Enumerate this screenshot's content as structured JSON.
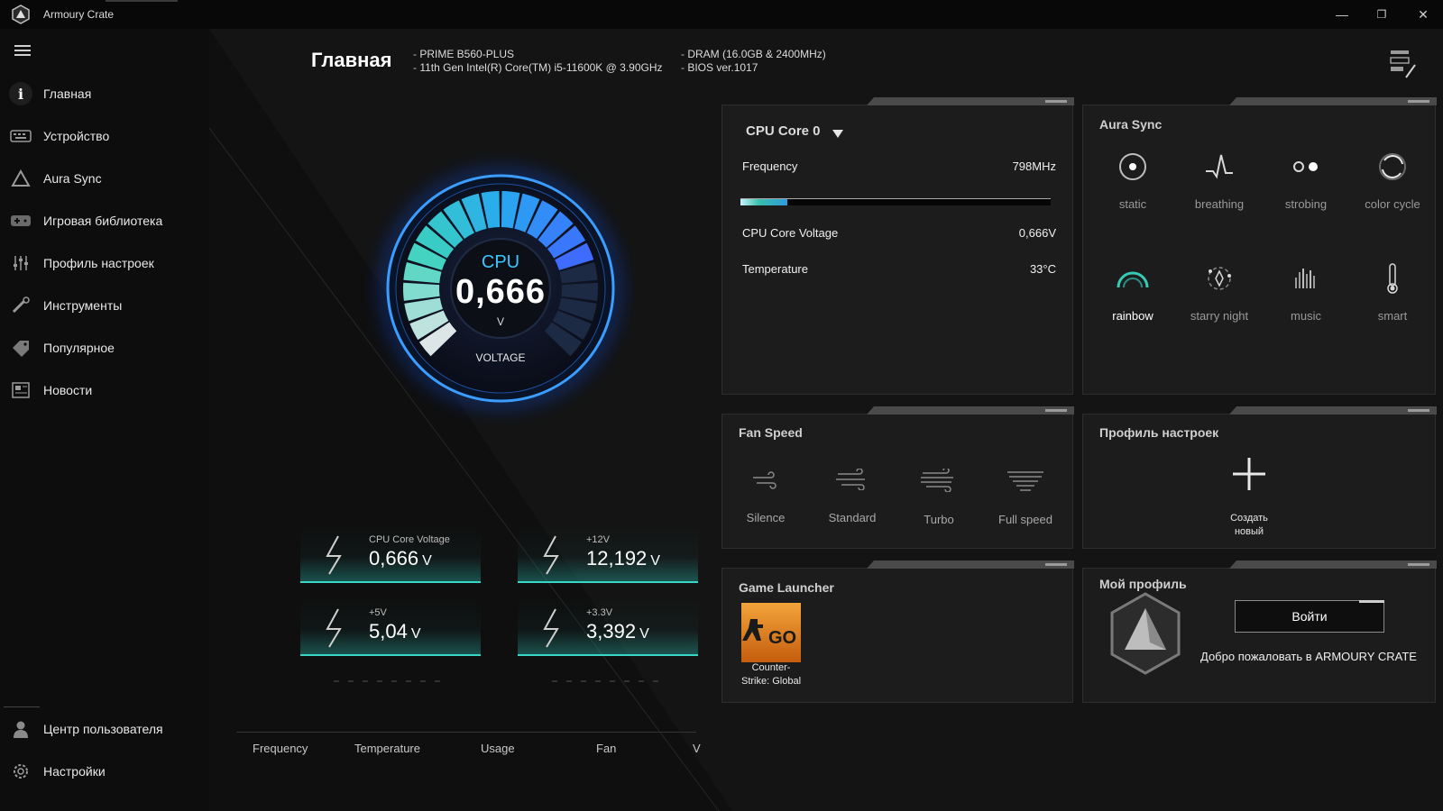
{
  "window": {
    "title": "Armoury Crate",
    "minimize": "—",
    "restore": "❐",
    "close": "✕"
  },
  "sidebar": {
    "items": [
      {
        "label": "Главная",
        "icon": "info-icon"
      },
      {
        "label": "Устройство",
        "icon": "keyboard-icon"
      },
      {
        "label": "Aura Sync",
        "icon": "aura-triangle-icon"
      },
      {
        "label": "Игровая библиотека",
        "icon": "gamepad-icon"
      },
      {
        "label": "Профиль настроек",
        "icon": "sliders-icon"
      },
      {
        "label": "Инструменты",
        "icon": "wrench-icon"
      },
      {
        "label": "Популярное",
        "icon": "tag-icon"
      },
      {
        "label": "Новости",
        "icon": "news-icon"
      }
    ],
    "bottom": [
      {
        "label": "Центр пользователя",
        "icon": "user-icon"
      },
      {
        "label": "Настройки",
        "icon": "gear-icon"
      }
    ]
  },
  "header": {
    "title": "Главная",
    "specs_left": [
      "PRIME B560-PLUS",
      "11th Gen Intel(R) Core(TM) i5-11600K @ 3.90GHz"
    ],
    "specs_right": [
      "DRAM (16.0GB & 2400MHz)",
      "BIOS ver.1017"
    ]
  },
  "gauge": {
    "label": "CPU",
    "value": "0,666",
    "unit": "V",
    "caption": "VOLTAGE",
    "level": 0.78
  },
  "voltages": [
    {
      "label": "CPU Core Voltage",
      "value": "0,666",
      "unit": "V"
    },
    {
      "label": "+12V",
      "value": "12,192",
      "unit": "V"
    },
    {
      "label": "+5V",
      "value": "5,04",
      "unit": "V"
    },
    {
      "label": "+3.3V",
      "value": "3,392",
      "unit": "V"
    }
  ],
  "bottom_tabs": [
    "Frequency",
    "Temperature",
    "Usage",
    "Fan",
    "V"
  ],
  "cpu_panel": {
    "selector": "CPU Core 0",
    "frequency_label": "Frequency",
    "frequency_value": "798MHz",
    "frequency_level": 0.15,
    "voltage_label": "CPU Core Voltage",
    "voltage_value": "0,666V",
    "temp_label": "Temperature",
    "temp_value": "33°C"
  },
  "aura": {
    "title": "Aura Sync",
    "effects": [
      {
        "label": "static",
        "icon": "static-icon"
      },
      {
        "label": "breathing",
        "icon": "breathing-icon"
      },
      {
        "label": "strobing",
        "icon": "strobing-icon"
      },
      {
        "label": "color cycle",
        "icon": "color-cycle-icon"
      },
      {
        "label": "rainbow",
        "icon": "rainbow-icon"
      },
      {
        "label": "starry night",
        "icon": "starry-night-icon"
      },
      {
        "label": "music",
        "icon": "music-icon"
      },
      {
        "label": "smart",
        "icon": "thermometer-icon"
      }
    ],
    "selected": "rainbow"
  },
  "fan": {
    "title": "Fan Speed",
    "modes": [
      "Silence",
      "Standard",
      "Turbo",
      "Full speed"
    ]
  },
  "profile": {
    "title": "Профиль настроек",
    "create_line1": "Создать",
    "create_line2": "новый"
  },
  "game_launcher": {
    "title": "Game Launcher",
    "game_line1": "Counter-",
    "game_line2": "Strike: Global",
    "tile_text": "GO"
  },
  "my_profile": {
    "title": "Мой профиль",
    "login": "Войти",
    "welcome": "Добро пожаловать в ARMOURY CRATE"
  },
  "colors": {
    "accent_cyan": "#38d6c4",
    "gauge_blue": "#2a8cff",
    "gauge_purple": "#7a2cff"
  }
}
